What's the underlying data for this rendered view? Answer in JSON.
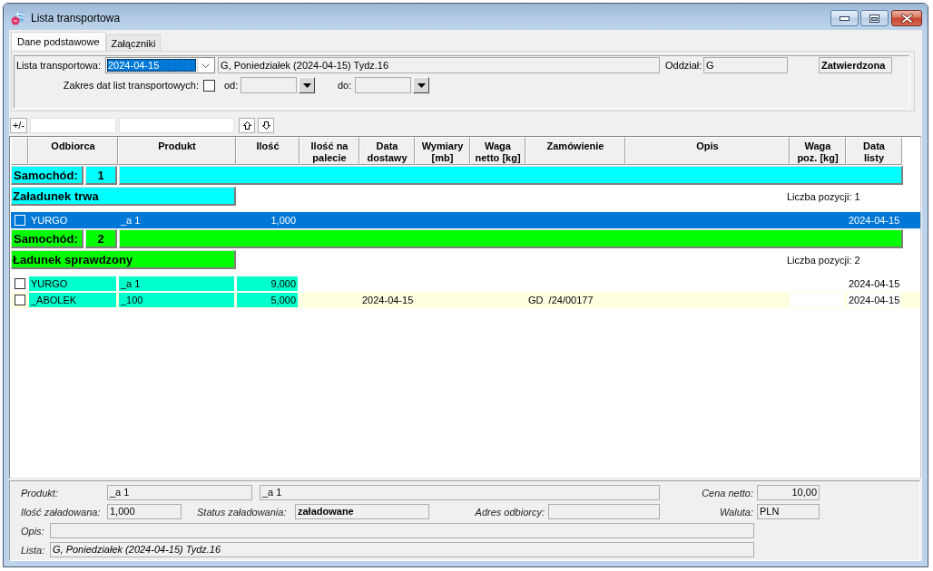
{
  "window": {
    "title": "Lista transportowa"
  },
  "tabs": [
    {
      "label": "Dane podstawowe",
      "selected": true
    },
    {
      "label": "Załączniki",
      "selected": false
    }
  ],
  "header_form": {
    "list_label": "Lista transportowa:",
    "list_date": "2024-04-15",
    "list_name": "G, Poniedziałek (2024-04-15) Tydz.16",
    "branch_label": "Oddział:",
    "branch": "G",
    "approval_status": "Zatwierdzona",
    "date_range_label": "Zakres dat list transportowych:",
    "date_range_checked": false,
    "date_from": {
      "label": "od:",
      "disabled": true
    },
    "date_to": {
      "label": "do:",
      "disabled": true
    }
  },
  "toolbar": {
    "toggle_label": "+/-"
  },
  "table": {
    "columns": [
      "Odbiorca",
      "Produkt",
      "Ilość",
      "Ilość na\npalecie",
      "Data\ndostawy",
      "Wymiary\n[mb]",
      "Waga\nnetto [kg]",
      "Zamówienie",
      "Opis",
      "Waga\npoz. [kg]",
      "Data\nlisty"
    ],
    "groups": [
      {
        "label": "Samochód:",
        "number": "1",
        "color": "#00ffff",
        "status": "Załadunek trwa",
        "count": "Liczba pozycji: 1",
        "rows": [
          {
            "selected": true,
            "checked": false,
            "cells": {
              "recipient": "YURGO",
              "product": "_a 1",
              "quantity": "1,000",
              "list_date": "2024-04-15"
            }
          }
        ]
      },
      {
        "label": "Samochód:",
        "number": "2",
        "color": "#00ff00",
        "status": "Ładunek sprawdzony",
        "count": "Liczba pozycji: 2",
        "rows": [
          {
            "selected": false,
            "checked": false,
            "highlighted": false,
            "color": "#00ffcc",
            "cells": {
              "recipient": "YURGO",
              "product": "_a 1",
              "quantity": "9,000",
              "list_date": "2024-04-15"
            }
          },
          {
            "selected": false,
            "checked": false,
            "highlighted": true,
            "color": "#00ffcc",
            "cells": {
              "recipient": "_ABOLEK",
              "product": "_100",
              "quantity": "5,000",
              "delivery_date": "2024-04-15",
              "order": "GD  /24/00177",
              "list_date": "2024-04-15"
            }
          }
        ]
      }
    ]
  },
  "details": {
    "product_label": "Produkt:",
    "product_code": "_a 1",
    "product_name": "_a 1",
    "price_label": "Cena netto:",
    "price": "10,00",
    "loaded_label": "Ilość załadowana:",
    "loaded": "1,000",
    "status_label": "Status załadowania:",
    "status": "załadowane",
    "address_label": "Adres odbiorcy:",
    "currency_label": "Waluta:",
    "currency": "PLN",
    "description_label": "Opis:",
    "list_label": "Lista:",
    "list": "G, Poniedziałek (2024-04-15) Tydz.16"
  }
}
